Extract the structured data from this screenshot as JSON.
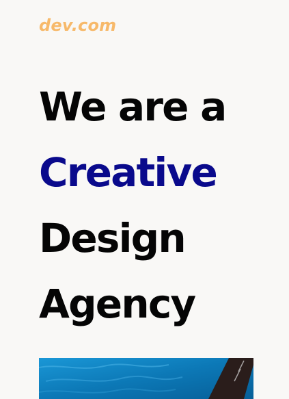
{
  "header": {
    "logo_text": "dev.com"
  },
  "hero": {
    "line1": "We are a",
    "line2": "Creative",
    "line3": "Design",
    "line4": "Agency"
  },
  "colors": {
    "background": "#f9f8f6",
    "logo": "#f7b96a",
    "heading": "#050505",
    "accent": "#0a0a8c",
    "image_water": "#0d7fbd"
  }
}
